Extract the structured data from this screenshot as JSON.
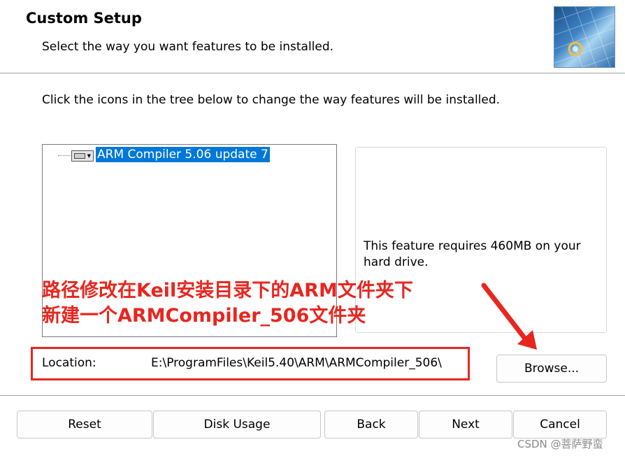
{
  "header": {
    "title": "Custom Setup",
    "subtitle": "Select the way you want features to be installed."
  },
  "instructions": "Click the icons in the tree below to change the way features will be installed.",
  "tree": {
    "items": [
      {
        "label": "ARM Compiler 5.06 update 7",
        "selected": true,
        "icon": "drive-icon"
      }
    ]
  },
  "feature_description": "This feature requires 460MB on your hard drive.",
  "annotation": {
    "line1": "路径修改在Keil安装目录下的ARM文件夹下",
    "line2": "新建一个ARMCompiler_506文件夹",
    "color": "#e8261f"
  },
  "location": {
    "label": "Location:",
    "value": "E:\\ProgramFiles\\Keil5.40\\ARM\\ARMCompiler_506\\"
  },
  "buttons": {
    "browse": "Browse...",
    "reset": "Reset",
    "disk_usage": "Disk Usage",
    "back": "Back",
    "next": "Next",
    "cancel": "Cancel"
  },
  "watermark": "CSDN @菩萨野蛮",
  "colors": {
    "selection": "#0078d7",
    "annotation_red": "#e8261f"
  }
}
